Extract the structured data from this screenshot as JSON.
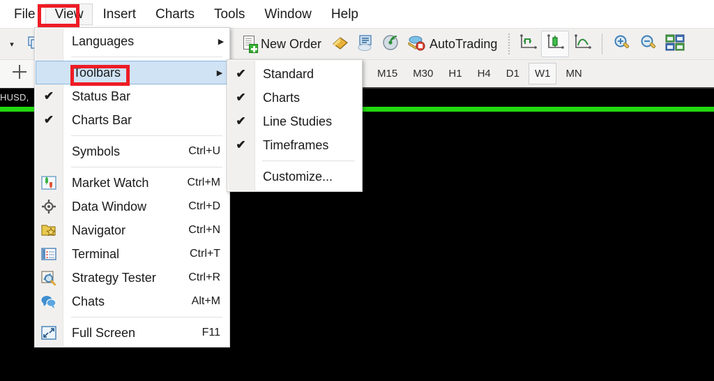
{
  "menubar": {
    "items": [
      {
        "label": "File",
        "active": false
      },
      {
        "label": "View",
        "active": true
      },
      {
        "label": "Insert",
        "active": false
      },
      {
        "label": "Charts",
        "active": false
      },
      {
        "label": "Tools",
        "active": false
      },
      {
        "label": "Window",
        "active": false
      },
      {
        "label": "Help",
        "active": false
      }
    ]
  },
  "toolbar": {
    "dropdown_arrow": "▾",
    "new_order_label": "New Order",
    "autotrading_label": "AutoTrading",
    "icons": {
      "new_order": "new-order-icon",
      "gold_bar": "gold-bar-icon",
      "metaquotes_id": "metaquotes-id-icon",
      "signals": "signals-icon",
      "autotrading": "autotrading-icon",
      "bar_chart": "bar-chart-icon",
      "candlestick_chart": "candlestick-chart-icon",
      "line_chart": "line-chart-icon",
      "zoom_in": "zoom-in-icon",
      "zoom_out": "zoom-out-icon",
      "tile_windows": "tile-windows-icon"
    }
  },
  "timeframes": {
    "crosshair_icon": "crosshair-icon",
    "items": [
      {
        "label": "M15",
        "selected": false
      },
      {
        "label": "M30",
        "selected": false
      },
      {
        "label": "H1",
        "selected": false
      },
      {
        "label": "H4",
        "selected": false
      },
      {
        "label": "D1",
        "selected": false
      },
      {
        "label": "W1",
        "selected": true
      },
      {
        "label": "MN",
        "selected": false
      }
    ]
  },
  "chart": {
    "tab_label": "HUSD,",
    "background_color": "#000000",
    "line_color": "#22d80f"
  },
  "view_menu": {
    "items": [
      {
        "label": "Languages",
        "accel": "",
        "checked": false,
        "submenu": true,
        "icon": "",
        "highlighted": false
      },
      {
        "separator": true
      },
      {
        "label": "Toolbars",
        "accel": "",
        "checked": false,
        "submenu": true,
        "icon": "",
        "highlighted": true
      },
      {
        "label": "Status Bar",
        "accel": "",
        "checked": true,
        "submenu": false,
        "icon": "",
        "highlighted": false
      },
      {
        "label": "Charts Bar",
        "accel": "",
        "checked": true,
        "submenu": false,
        "icon": "",
        "highlighted": false
      },
      {
        "separator": true
      },
      {
        "label": "Symbols",
        "accel": "Ctrl+U",
        "checked": false,
        "submenu": false,
        "icon": "",
        "highlighted": false
      },
      {
        "separator": true
      },
      {
        "label": "Market Watch",
        "accel": "Ctrl+M",
        "checked": false,
        "submenu": false,
        "icon": "market-watch-icon",
        "highlighted": false
      },
      {
        "label": "Data Window",
        "accel": "Ctrl+D",
        "checked": false,
        "submenu": false,
        "icon": "data-window-icon",
        "highlighted": false
      },
      {
        "label": "Navigator",
        "accel": "Ctrl+N",
        "checked": false,
        "submenu": false,
        "icon": "navigator-icon",
        "highlighted": false
      },
      {
        "label": "Terminal",
        "accel": "Ctrl+T",
        "checked": false,
        "submenu": false,
        "icon": "terminal-icon",
        "highlighted": false
      },
      {
        "label": "Strategy Tester",
        "accel": "Ctrl+R",
        "checked": false,
        "submenu": false,
        "icon": "strategy-tester-icon",
        "highlighted": false
      },
      {
        "label": "Chats",
        "accel": "Alt+M",
        "checked": false,
        "submenu": false,
        "icon": "chats-icon",
        "highlighted": false
      },
      {
        "separator": true
      },
      {
        "label": "Full Screen",
        "accel": "F11",
        "checked": false,
        "submenu": false,
        "icon": "full-screen-icon",
        "highlighted": false
      }
    ]
  },
  "toolbars_submenu": {
    "items": [
      {
        "label": "Standard",
        "checked": true
      },
      {
        "label": "Charts",
        "checked": true
      },
      {
        "label": "Line Studies",
        "checked": true
      },
      {
        "label": "Timeframes",
        "checked": true
      },
      {
        "separator": true
      },
      {
        "label": "Customize...",
        "checked": false
      }
    ]
  },
  "annotations": {
    "highlight_color": "#ee1c25",
    "boxes": [
      {
        "target": "View menu"
      },
      {
        "target": "Toolbars menu item"
      }
    ]
  },
  "glyphs": {
    "check": "✔",
    "submenu_arrow": "▶"
  }
}
